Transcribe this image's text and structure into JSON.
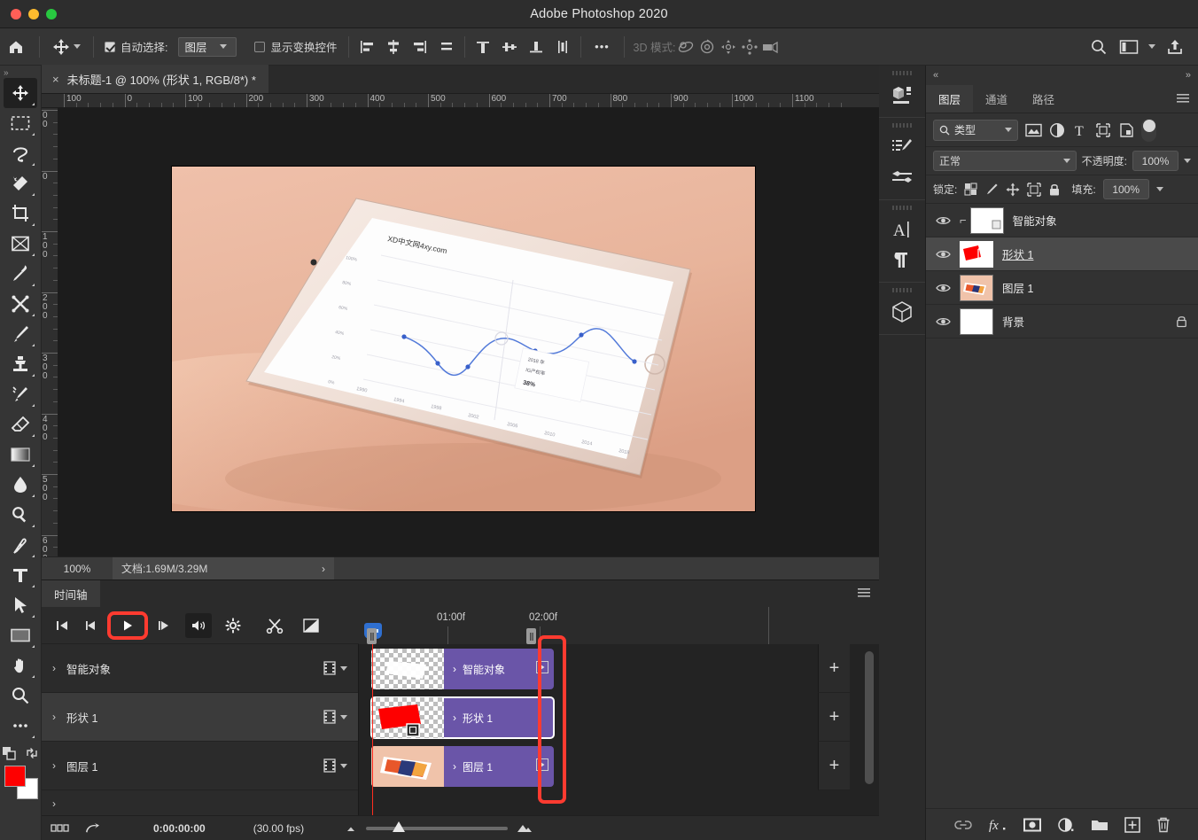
{
  "window": {
    "title": "Adobe Photoshop 2020",
    "traffic_lights": [
      "close",
      "minimize",
      "zoom"
    ]
  },
  "options_bar": {
    "home_icon": "home-icon",
    "tool_icon": "move-tool-icon",
    "auto_select_label": "自动选择:",
    "auto_select_checked": true,
    "auto_select_value": "图层",
    "show_transform_label": "显示变换控件",
    "show_transform_checked": false,
    "align_icons": [
      "align-left-edges-icon",
      "align-horizontal-centers-icon",
      "align-right-edges-icon",
      "align-top-edges-icon"
    ],
    "distribute_icons": [
      "distribute-top-edges-icon",
      "distribute-vertical-centers-icon",
      "distribute-bottom-edges-icon",
      "distribute-horizontal-icon"
    ],
    "more_label": "•••",
    "mode_3d_label": "3D 模式:",
    "mode_3d_icons": [
      "orbit-3d-icon",
      "roll-3d-icon",
      "pan-3d-icon",
      "slide-3d-icon",
      "camera-3d-icon"
    ],
    "right_icons": [
      "search-icon",
      "workspace-icon",
      "chevron-down-icon",
      "share-icon"
    ]
  },
  "toolbar": {
    "tools": [
      {
        "name": "move-tool",
        "active": true
      },
      {
        "name": "marquee-tool",
        "active": false
      },
      {
        "name": "lasso-tool",
        "active": false
      },
      {
        "name": "quick-select-tool",
        "active": false
      },
      {
        "name": "crop-tool",
        "active": false
      },
      {
        "name": "frame-tool",
        "active": false
      },
      {
        "name": "eyedropper-tool",
        "active": false
      },
      {
        "name": "healing-brush-tool",
        "active": false
      },
      {
        "name": "brush-tool",
        "active": false
      },
      {
        "name": "clone-stamp-tool",
        "active": false
      },
      {
        "name": "history-brush-tool",
        "active": false
      },
      {
        "name": "eraser-tool",
        "active": false
      },
      {
        "name": "gradient-tool",
        "active": false
      },
      {
        "name": "blur-tool",
        "active": false
      },
      {
        "name": "dodge-tool",
        "active": false
      },
      {
        "name": "pen-tool",
        "active": false
      },
      {
        "name": "type-tool",
        "active": false
      },
      {
        "name": "path-selection-tool",
        "active": false
      },
      {
        "name": "rectangle-tool",
        "active": false
      },
      {
        "name": "hand-tool",
        "active": false
      },
      {
        "name": "zoom-tool",
        "active": false
      },
      {
        "name": "edit-toolbar",
        "active": false
      }
    ],
    "foreground_color": "#fe0000",
    "background_color": "#ffffff"
  },
  "document": {
    "tab_title": "未标题-1 @ 100% (形状 1, RGB/8*) *",
    "close_label": "×"
  },
  "rulers": {
    "h_labels": [
      "100",
      "0",
      "100",
      "200",
      "300",
      "400",
      "500",
      "600",
      "700",
      "800",
      "900",
      "1000",
      "1100"
    ],
    "v_labels": [
      "00",
      "0",
      "100",
      "200",
      "300",
      "400",
      "500",
      "600"
    ]
  },
  "canvas": {
    "artwork_description": "tablet-mockup-on-peach-background",
    "chart_title": "XD中文网4xy.com"
  },
  "canvas_status": {
    "zoom": "100%",
    "doc_label": "文档:1.69M/3.29M",
    "expand_arrow": "›"
  },
  "timeline": {
    "panel_tab": "时间轴",
    "panel_menu_icon": "hamburger-menu-icon",
    "controls": [
      {
        "name": "go-to-first-frame-button",
        "glyph": "first"
      },
      {
        "name": "previous-frame-button",
        "glyph": "prev"
      },
      {
        "name": "play-button",
        "glyph": "play",
        "highlighted": true
      },
      {
        "name": "next-frame-button",
        "glyph": "next"
      },
      {
        "name": "audio-button",
        "glyph": "audio"
      },
      {
        "name": "settings-button",
        "glyph": "gear"
      },
      {
        "name": "split-clip-button",
        "glyph": "scissors"
      },
      {
        "name": "transition-button",
        "glyph": "transition"
      }
    ],
    "time_marks": [
      "01:00f",
      "02:00f"
    ],
    "tracks": [
      {
        "name": "智能对象",
        "selected": false,
        "thumb": "checker-white-shape"
      },
      {
        "name": "形状 1",
        "selected": true,
        "thumb": "checker-red-shape"
      },
      {
        "name": "图层 1",
        "selected": false,
        "thumb": "tablet-photo"
      }
    ],
    "add_button_label": "+",
    "status": {
      "render_icon": "render-icon",
      "convert_icon": "convert-to-frame-icon",
      "timecode": "0:00:00:00",
      "fps": "(30.00 fps)",
      "zoom_out_icon": "small-mountain-icon",
      "zoom_in_icon": "large-mountain-icon"
    }
  },
  "rail": {
    "groups": [
      [
        {
          "name": "libraries-icon"
        }
      ],
      [
        {
          "name": "adjustments-icon"
        },
        {
          "name": "styles-icon"
        }
      ],
      [
        {
          "name": "character-icon"
        },
        {
          "name": "paragraph-icon"
        }
      ],
      [
        {
          "name": "3d-icon"
        }
      ]
    ],
    "collapse_icon": "«",
    "expand_icon": "»"
  },
  "layers_panel": {
    "tabs": [
      {
        "label": "图层",
        "active": true
      },
      {
        "label": "通道",
        "active": false
      },
      {
        "label": "路径",
        "active": false
      }
    ],
    "menu_icon": "hamburger-menu-icon",
    "filter": {
      "search_icon": "search-icon",
      "kind_label": "类型",
      "chevron": "chevron-down-icon",
      "filter_icons": [
        "pixel-layer-filter-icon",
        "adjustment-layer-filter-icon",
        "type-layer-filter-icon",
        "shape-layer-filter-icon",
        "smart-object-filter-icon"
      ],
      "toggle_on": true
    },
    "blend": {
      "mode": "正常",
      "opacity_label": "不透明度:",
      "opacity_value": "100%"
    },
    "lock": {
      "label": "锁定:",
      "icons": [
        "lock-transparent-pixels-icon",
        "lock-image-pixels-icon",
        "lock-position-icon",
        "lock-artboard-icon",
        "lock-all-icon"
      ],
      "fill_label": "填充:",
      "fill_value": "100%"
    },
    "layers": [
      {
        "name": "智能对象",
        "selected": false,
        "visible": true,
        "clipped": true,
        "thumb": "checker-white",
        "locked": false
      },
      {
        "name": "形状 1",
        "selected": true,
        "visible": true,
        "clipped": false,
        "thumb": "checker-red",
        "locked": false
      },
      {
        "name": "图层 1",
        "selected": false,
        "visible": true,
        "clipped": false,
        "thumb": "tablet-photo",
        "locked": false
      },
      {
        "name": "背景",
        "selected": false,
        "visible": true,
        "clipped": false,
        "thumb": "white",
        "locked": true
      }
    ],
    "footer_icons": [
      "link-layers-icon",
      "add-layer-style-icon",
      "add-layer-mask-icon",
      "new-adjustment-layer-icon",
      "new-group-icon",
      "new-layer-icon",
      "delete-layer-icon"
    ]
  },
  "colors": {
    "accent_red": "#ff3b30",
    "clip_purple": "#6a55a8",
    "panel_bg": "#323232",
    "toolbar_bg": "#353535",
    "canvas_bg": "#1c1c1c",
    "artboard_bg": "#e9b9a2"
  }
}
